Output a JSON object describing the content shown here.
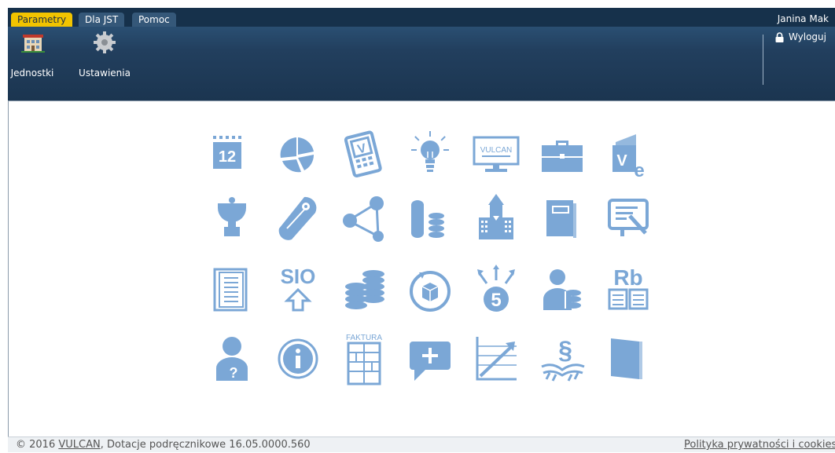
{
  "colors": {
    "header_bg": "#1e3a56",
    "tab_active": "#f2c400",
    "tab_inactive": "#355879",
    "icon_fill": "#7ba7d6"
  },
  "tabs": [
    {
      "label": "Parametry",
      "active": true
    },
    {
      "label": "Dla JST",
      "active": false
    },
    {
      "label": "Pomoc",
      "active": false
    }
  ],
  "user": {
    "name": "Janina Mak"
  },
  "ribbon": {
    "buttons": [
      {
        "label": "Jednostki",
        "icon": "building-icon"
      },
      {
        "label": "Ustawienia",
        "icon": "gear-icon"
      }
    ],
    "logout_label": "Wyloguj"
  },
  "grid_icons": [
    [
      "calendar-icon",
      "pie-chart-icon",
      "mobile-doc-icon",
      "lightbulb-icon",
      "monitor-icon",
      "briefcase-icon",
      "e-document-icon"
    ],
    [
      "trophy-icon",
      "scroll-icon",
      "network-icon",
      "coins-roll-icon",
      "building-tower-icon",
      "book-icon",
      "presentation-icon"
    ],
    [
      "register-book-icon",
      "sio-upload-icon",
      "money-stacks-icon",
      "rotate-box-icon",
      "grade-arrows-icon",
      "person-coins-icon",
      "rb-report-icon"
    ],
    [
      "person-help-icon",
      "info-icon",
      "invoice-icon",
      "chat-plus-icon",
      "trend-chart-icon",
      "paragraph-law-icon",
      "folder-book-icon"
    ]
  ],
  "grid_text": {
    "sio": "SIO",
    "faktura": "FAKTURA",
    "rb": "Rb",
    "calendar_day": "12",
    "grade": "5",
    "vulcan": "VULCAN",
    "paragraph": "§"
  },
  "footer": {
    "copyright": "© 2016",
    "link": "VULCAN",
    "rest": ", Dotacje podręcznikowe 16.05.0000.560",
    "privacy": "Polityka prywatności i cookies"
  }
}
